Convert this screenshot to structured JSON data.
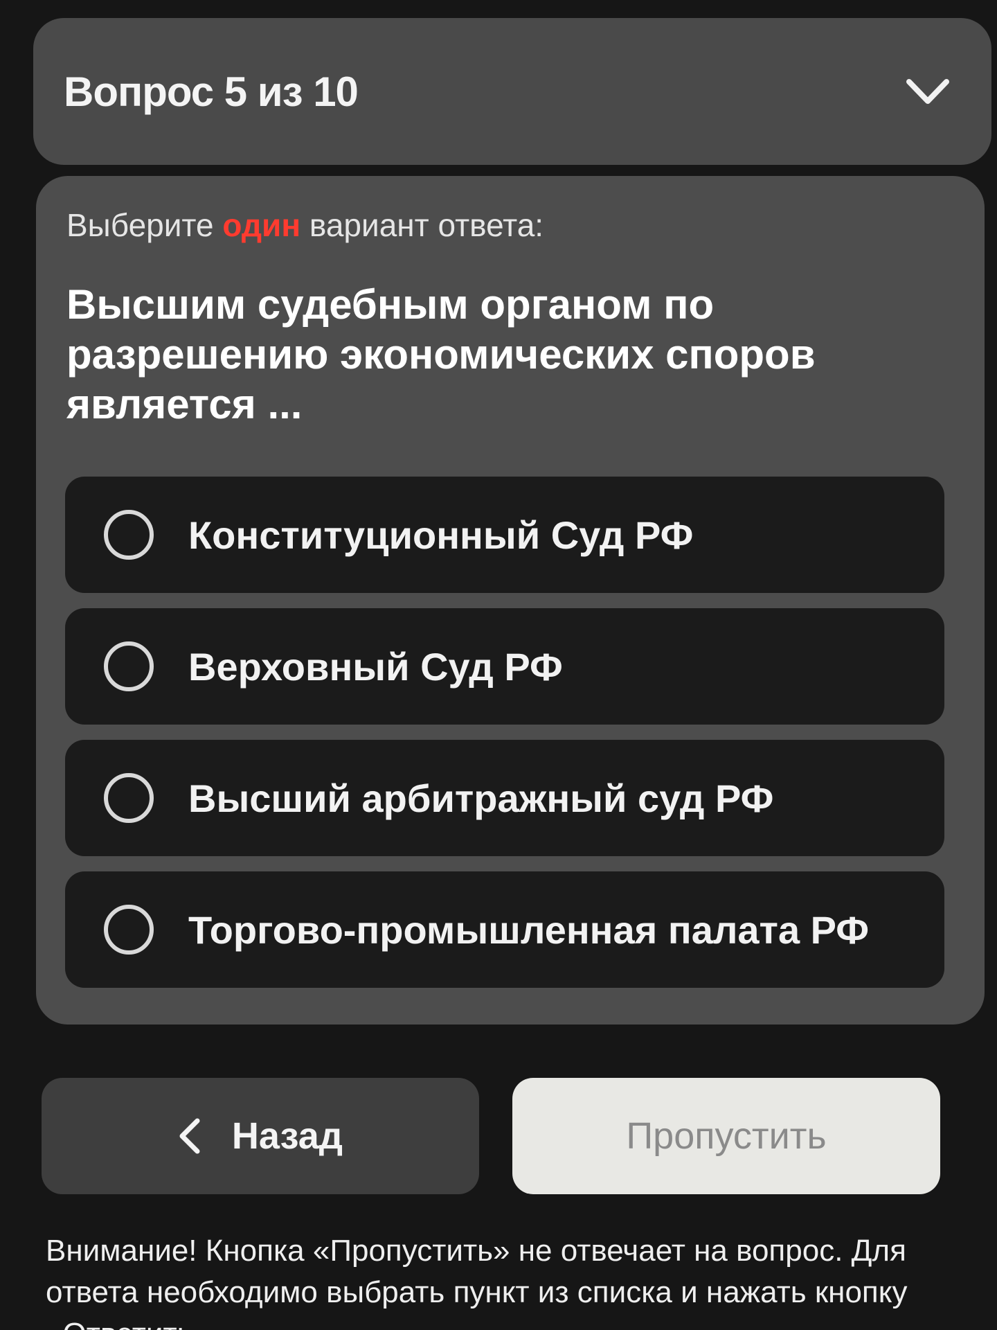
{
  "header": {
    "counter": "Вопрос 5 из 10",
    "expand_icon": "chevron-down-icon"
  },
  "question": {
    "instruction_prefix": "Выберите ",
    "instruction_accent": "один",
    "instruction_suffix": " вариант ответа:",
    "text": "Высшим судебным органом по разрешению экономических споров является ..."
  },
  "options": [
    {
      "label": "Конституционный Суд РФ",
      "selected": false
    },
    {
      "label": "Верховный Суд РФ",
      "selected": false
    },
    {
      "label": "Высший арбитражный суд РФ",
      "selected": false
    },
    {
      "label": "Торгово-промышленная палата РФ",
      "selected": false
    }
  ],
  "buttons": {
    "back_label": "Назад",
    "back_icon": "chevron-left-icon",
    "skip_label": "Пропустить"
  },
  "notice": "Внимание! Кнопка «Пропустить» не отвечает на вопрос. Для ответа необходимо выбрать пункт из списка и нажать кнопку «Ответить».",
  "colors": {
    "accent": "#ff3b2f",
    "card": "#4d4d4d",
    "option_bg": "#1b1b1b",
    "skip_bg": "#e8e8e4"
  }
}
